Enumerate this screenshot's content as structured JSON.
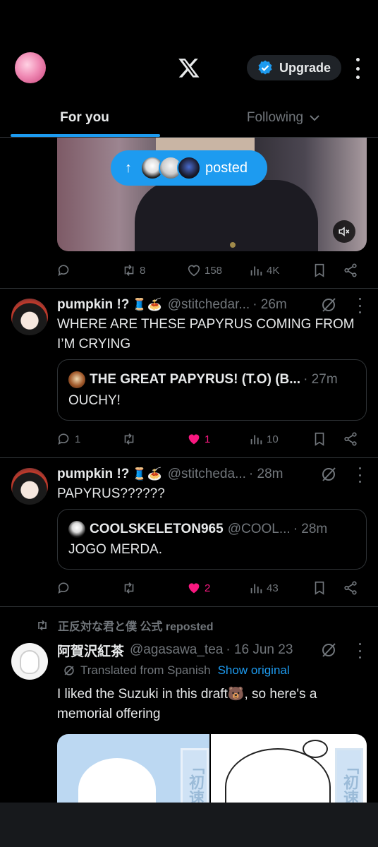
{
  "header": {
    "upgrade_label": "Upgrade",
    "tabs": [
      {
        "label": "For you",
        "active": true
      },
      {
        "label": "Following",
        "active": false
      }
    ]
  },
  "posted_pill": {
    "label": "posted",
    "arrow": "↑"
  },
  "post0": {
    "stats": {
      "reposts": "8",
      "likes": "158",
      "views": "4K"
    }
  },
  "post1": {
    "name": "pumpkin !?",
    "emoji": "🧵🍝",
    "handle": "@stitchedar...",
    "time": "· 26m",
    "text": "WHERE ARE THESE PAPYRUS COMING FROM I’M CRYING",
    "quote": {
      "name": "THE GREAT PAPYRUS! (T.O) (B...",
      "time": "· 27m",
      "text": "OUCHY!"
    },
    "stats": {
      "replies": "1",
      "likes": "1",
      "views": "10"
    }
  },
  "post2": {
    "name": "pumpkin !?",
    "emoji": "🧵🍝",
    "handle": "@stitcheda...",
    "time": "· 28m",
    "text": "PAPYRUS??????",
    "quote": {
      "name": "COOLSKELETON965",
      "handle": "@COOL...",
      "time": "· 28m",
      "text": "JOGO MERDA."
    },
    "stats": {
      "likes": "2",
      "views": "43"
    }
  },
  "post3": {
    "repost_by": "正反対な君と僕 公式 reposted",
    "name": "阿賀沢紅茶",
    "handle": "@agasawa_tea",
    "time": "· 16 Jun 23",
    "translated": "Translated from Spanish",
    "show_original": "Show original",
    "text": "I liked the Suzuki in this draft🐻, so here's a memorial offering",
    "stamp_text": "「初速",
    "stamp_text2": "「初速"
  },
  "colors": {
    "accent": "#1d9bf0",
    "like": "#f91880",
    "muted": "#71767b",
    "text": "#e7e9ea",
    "bg": "#000000"
  }
}
